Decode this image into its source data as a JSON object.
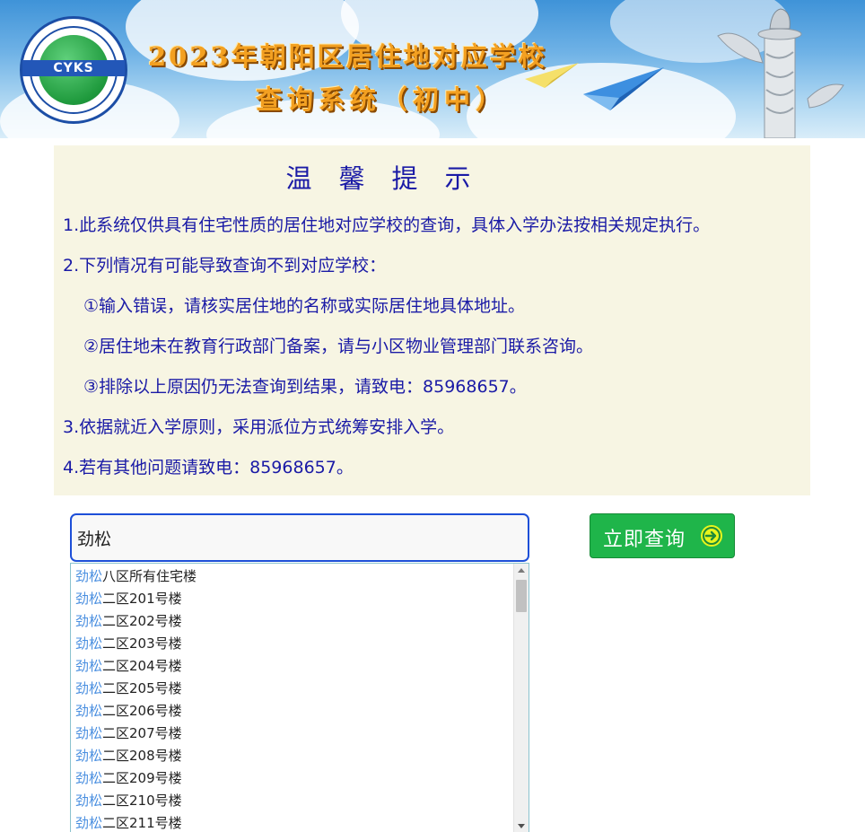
{
  "banner": {
    "logo_text": "CYKS",
    "title": "2023年朝阳区居住地对应学校",
    "subtitle": "查询系统（初中）"
  },
  "notice": {
    "title": "温馨提示",
    "lines": [
      "1.此系统仅供具有住宅性质的居住地对应学校的查询，具体入学办法按相关规定执行。",
      "2.下列情况有可能导致查询不到对应学校：",
      "①输入错误，请核实居住地的名称或实际居住地具体地址。",
      "②居住地未在教育行政部门备案，请与小区物业管理部门联系咨询。",
      "③排除以上原因仍无法查询到结果，请致电：85968657。",
      "3.依据就近入学原则，采用派位方式统筹安排入学。",
      "4.若有其他问题请致电：85968657。"
    ]
  },
  "search": {
    "value": "劲松",
    "button_label": "立即查询"
  },
  "suggestions": {
    "highlight": "劲松",
    "items": [
      "八区所有住宅楼",
      "二区201号楼",
      "二区202号楼",
      "二区203号楼",
      "二区204号楼",
      "二区205号楼",
      "二区206号楼",
      "二区207号楼",
      "二区208号楼",
      "二区209号楼",
      "二区210号楼",
      "二区211号楼"
    ]
  },
  "colors": {
    "notice_text": "#1a1aa6",
    "notice_bg": "#f7f5e3",
    "button_bg": "#1fb54a",
    "highlight": "#4a8fe0",
    "input_border": "#1d4fd8"
  }
}
